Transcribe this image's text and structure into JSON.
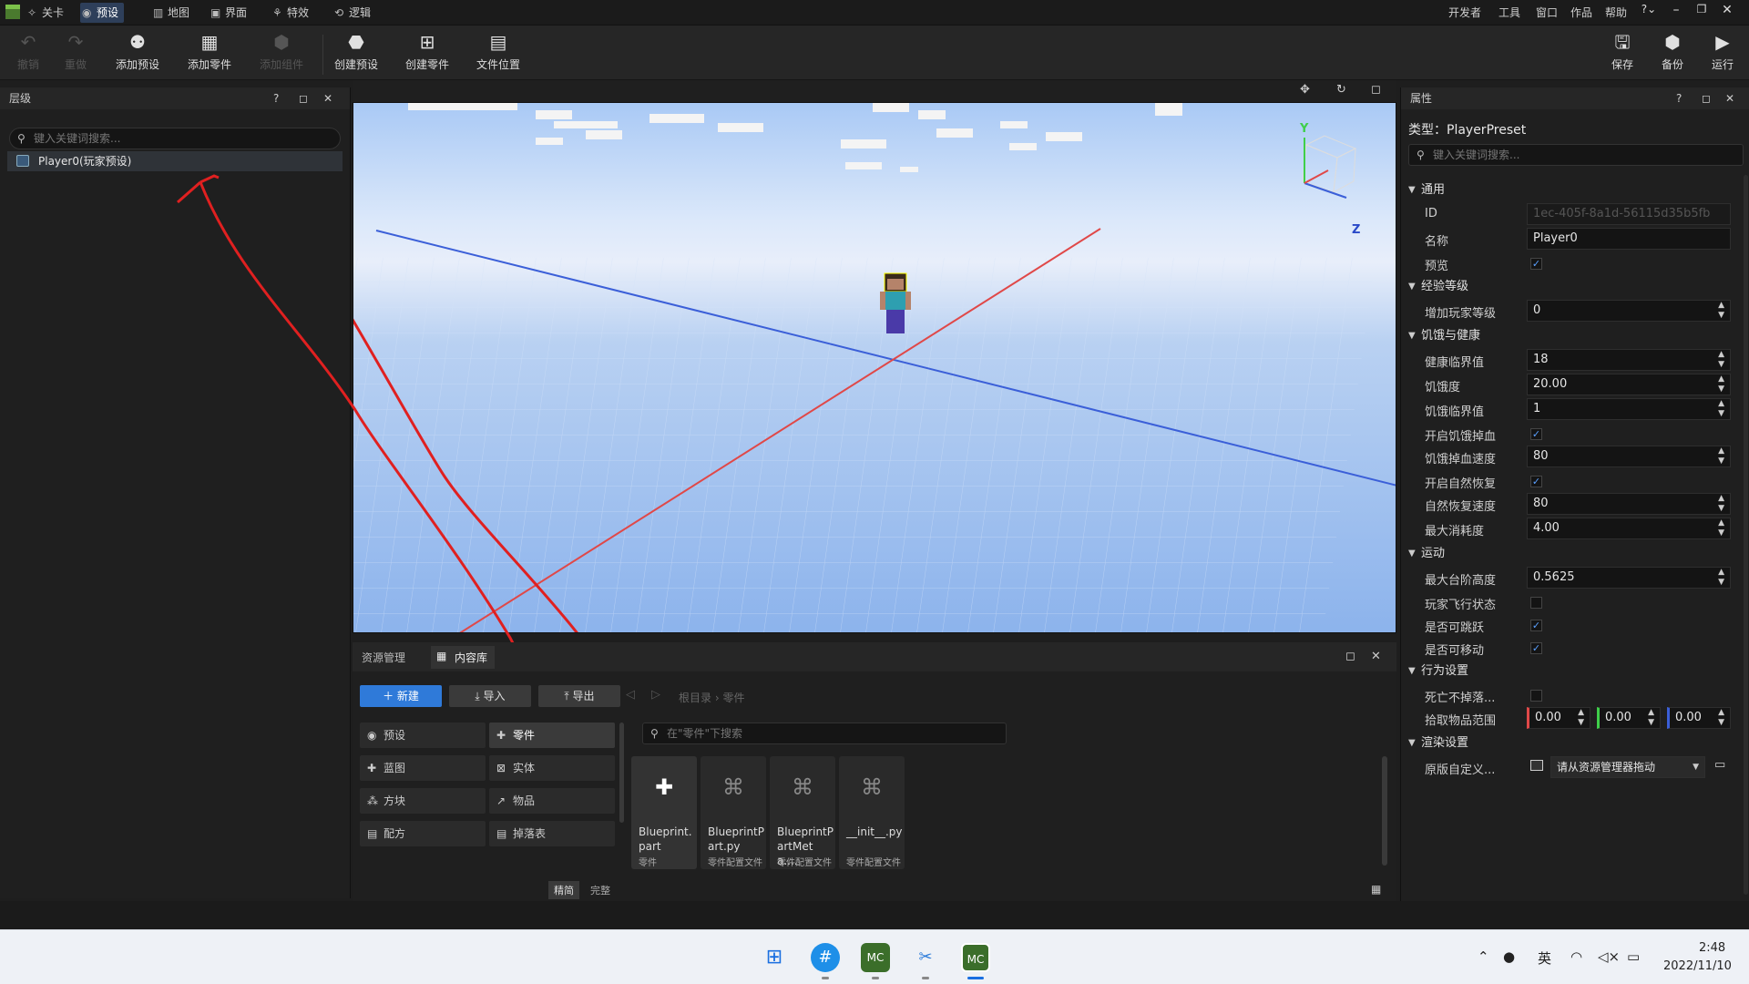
{
  "menubar": {
    "tabs": [
      {
        "label": "关卡",
        "icon": "level-icon"
      },
      {
        "label": "预设",
        "icon": "preset-icon"
      },
      {
        "label": "地图",
        "icon": "map-icon"
      },
      {
        "label": "界面",
        "icon": "ui-icon"
      },
      {
        "label": "特效",
        "icon": "effects-icon"
      },
      {
        "label": "逻辑",
        "icon": "logic-icon"
      }
    ],
    "right_menu": [
      "开发者",
      "工具",
      "窗口",
      "作品",
      "帮助"
    ]
  },
  "toolbar": {
    "left": [
      {
        "label": "撤销",
        "icon": "undo-icon",
        "disabled": true
      },
      {
        "label": "重做",
        "icon": "redo-icon",
        "disabled": true
      },
      {
        "label": "添加预设",
        "icon": "add-preset-icon"
      },
      {
        "label": "添加零件",
        "icon": "add-part-icon"
      },
      {
        "label": "添加组件",
        "icon": "add-component-icon",
        "disabled": true
      },
      {
        "label": "创建预设",
        "icon": "create-preset-icon"
      },
      {
        "label": "创建零件",
        "icon": "create-part-icon"
      },
      {
        "label": "文件位置",
        "icon": "file-location-icon"
      }
    ],
    "right": [
      {
        "label": "保存",
        "icon": "save-icon"
      },
      {
        "label": "备份",
        "icon": "backup-icon"
      },
      {
        "label": "运行",
        "icon": "run-icon"
      }
    ]
  },
  "hierarchy": {
    "title": "层级",
    "search_placeholder": "键入关键词搜索...",
    "items": [
      {
        "label": "Player0(玩家预设)"
      }
    ]
  },
  "content": {
    "tabs": [
      "资源管理",
      "内容库"
    ],
    "new_label": "新建",
    "import_label": "导入",
    "export_label": "导出",
    "breadcrumb": [
      "根目录",
      "零件"
    ],
    "search_placeholder": "在\"零件\"下搜索",
    "categories": [
      {
        "label": "预设",
        "icon": "preset-icon"
      },
      {
        "label": "零件",
        "icon": "part-icon"
      },
      {
        "label": "蓝图",
        "icon": "blueprint-icon"
      },
      {
        "label": "实体",
        "icon": "entity-icon"
      },
      {
        "label": "方块",
        "icon": "block-icon"
      },
      {
        "label": "物品",
        "icon": "item-icon"
      },
      {
        "label": "配方",
        "icon": "recipe-icon"
      },
      {
        "label": "掉落表",
        "icon": "loot-table-icon"
      }
    ],
    "assets": [
      {
        "name": "Blueprint.part",
        "type": "零件",
        "icon": "puzzle-icon"
      },
      {
        "name": "BlueprintPart.py",
        "type": "零件配置文件",
        "icon": "python-icon"
      },
      {
        "name": "BlueprintPartMeta....",
        "type": "零件配置文件",
        "icon": "python-icon"
      },
      {
        "name": "__init__.py",
        "type": "零件配置文件",
        "icon": "python-icon"
      }
    ],
    "view_modes": [
      "精简",
      "完整"
    ]
  },
  "properties": {
    "title": "属性",
    "type_label": "类型：PlayerPreset",
    "search_placeholder": "键入关键词搜索...",
    "sections": [
      {
        "title": "通用",
        "rows": [
          {
            "label": "ID",
            "value": "1ec-405f-8a1d-56115d35b5fb",
            "kind": "readonly"
          },
          {
            "label": "名称",
            "value": "Player0",
            "kind": "text"
          },
          {
            "label": "预览",
            "value": "✓",
            "kind": "check"
          }
        ]
      },
      {
        "title": "经验等级",
        "rows": [
          {
            "label": "增加玩家等级",
            "value": "0",
            "kind": "number"
          }
        ]
      },
      {
        "title": "饥饿与健康",
        "rows": [
          {
            "label": "健康临界值",
            "value": "18",
            "kind": "number"
          },
          {
            "label": "饥饿度",
            "value": "20.00",
            "kind": "number"
          },
          {
            "label": "饥饿临界值",
            "value": "1",
            "kind": "number"
          },
          {
            "label": "开启饥饿掉血",
            "value": "✓",
            "kind": "check"
          },
          {
            "label": "饥饿掉血速度",
            "value": "80",
            "kind": "number"
          },
          {
            "label": "开启自然恢复",
            "value": "✓",
            "kind": "check"
          },
          {
            "label": "自然恢复速度",
            "value": "80",
            "kind": "number"
          },
          {
            "label": "最大消耗度",
            "value": "4.00",
            "kind": "number"
          }
        ]
      },
      {
        "title": "运动",
        "rows": [
          {
            "label": "最大台阶高度",
            "value": "0.5625",
            "kind": "number"
          },
          {
            "label": "玩家飞行状态",
            "value": "",
            "kind": "check"
          },
          {
            "label": "是否可跳跃",
            "value": "✓",
            "kind": "check"
          },
          {
            "label": "是否可移动",
            "value": "✓",
            "kind": "check"
          }
        ]
      },
      {
        "title": "行为设置",
        "rows": [
          {
            "label": "死亡不掉落...",
            "value": "",
            "kind": "check"
          },
          {
            "label": "拾取物品范围",
            "value": "",
            "kind": "vec3",
            "vals": [
              "0.00",
              "0.00",
              "0.00"
            ]
          }
        ]
      },
      {
        "title": "渲染设置",
        "rows": [
          {
            "label": "原版自定义...",
            "value": "请从资源管理器拖动",
            "kind": "drop"
          }
        ]
      }
    ]
  },
  "viewport": {
    "axis_y": "Y",
    "axis_z": "Z"
  },
  "taskbar": {
    "tray_lang": "英",
    "time": "2:48",
    "date": "2022/11/10"
  }
}
